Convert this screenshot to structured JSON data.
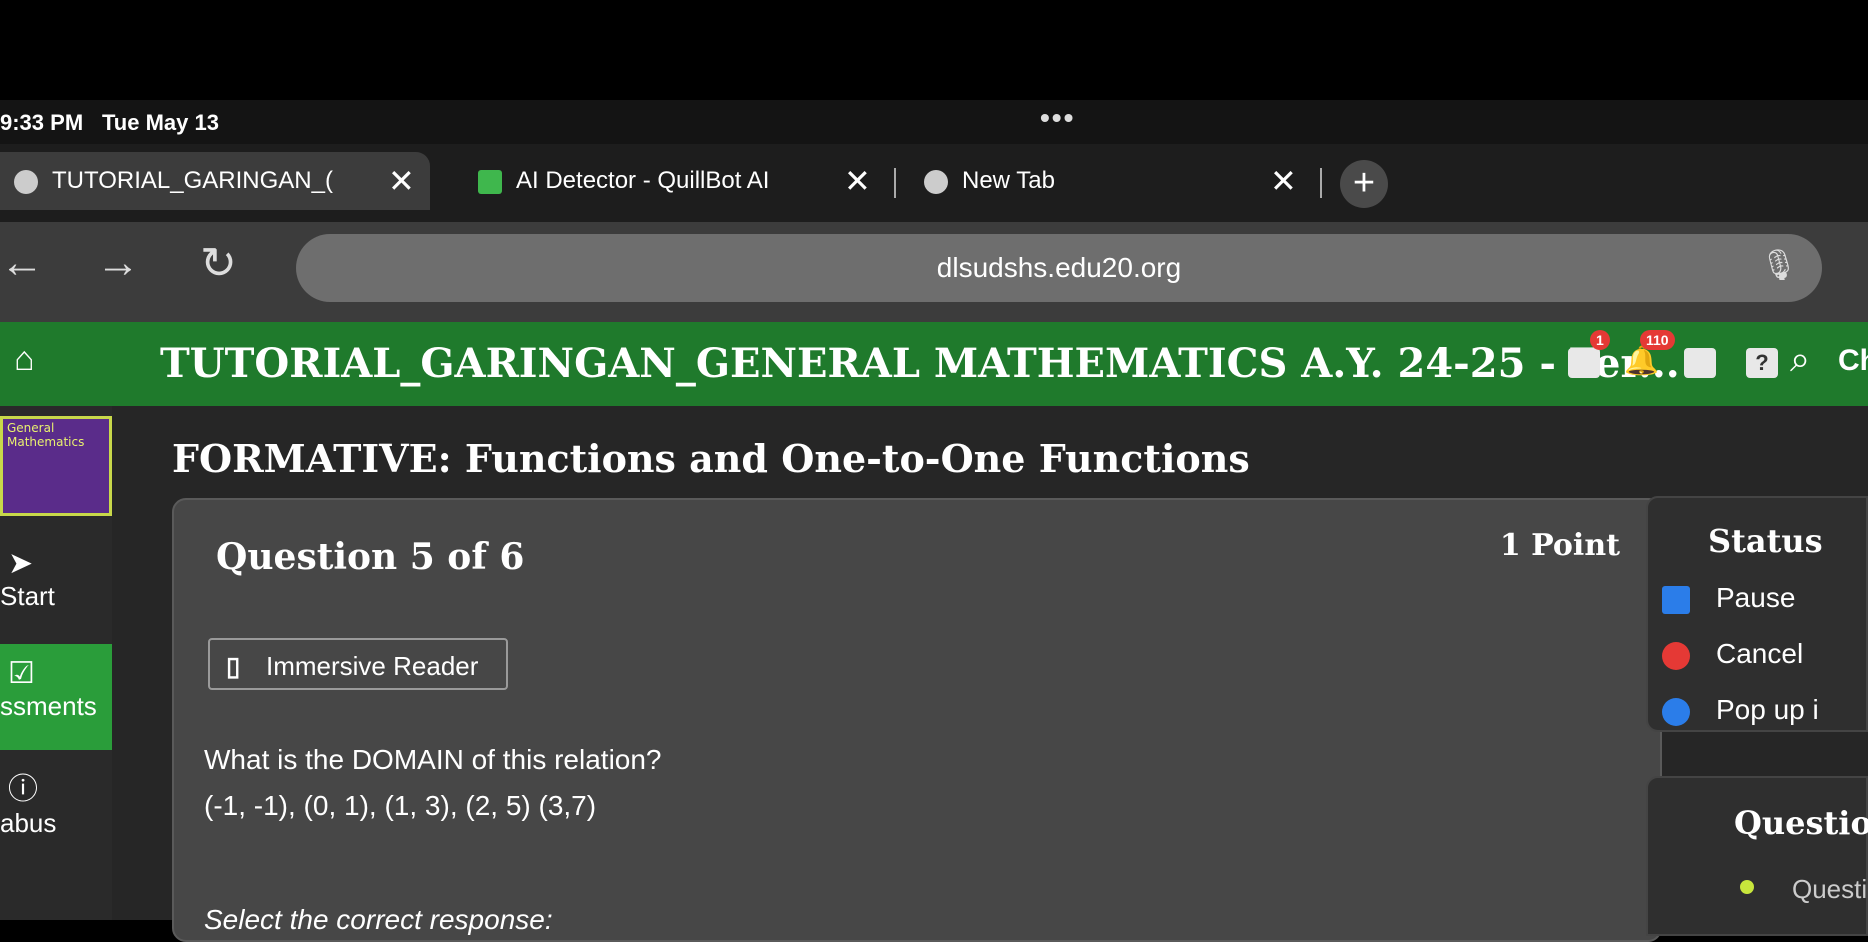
{
  "status_bar": {
    "time": "9:33 PM",
    "date": "Tue May 13",
    "dots": "•••"
  },
  "browser": {
    "tabs": [
      {
        "label": "TUTORIAL_GARINGAN_("
      },
      {
        "label": "AI Detector - QuillBot AI"
      },
      {
        "label": "New Tab"
      }
    ],
    "url": "dlsudshs.edu20.org",
    "new_tab_label": "+"
  },
  "header": {
    "title": "TUTORIAL_GARINGAN_GENERAL MATHEMATICS A.Y. 24-25 - Ter...",
    "mail_badge": "1",
    "notif_badge": "110",
    "search_text": "Ch"
  },
  "sidebar": {
    "course_logo_text": "General Mathematics",
    "items": [
      {
        "label": "Start"
      },
      {
        "label": "ssments"
      },
      {
        "label": "abus"
      }
    ]
  },
  "main": {
    "quiz_title": "FORMATIVE: Functions and One-to-One Functions",
    "question_number": "Question 5 of 6",
    "points": "1 Point",
    "immersive_reader": "Immersive Reader",
    "question_text": "What is the DOMAIN of this relation?",
    "relation": "(-1, -1), (0, 1), (1, 3), (2, 5) (3,7)",
    "select_prompt": "Select the correct response:"
  },
  "status_panel": {
    "heading": "Status",
    "items": [
      {
        "label": "Pause",
        "color": "#2b7de9"
      },
      {
        "label": "Cancel",
        "color": "#e53935"
      },
      {
        "label": "Pop up i",
        "color": "#2b7de9"
      }
    ]
  },
  "questions_panel": {
    "heading": "Questions",
    "item": "Questi"
  }
}
